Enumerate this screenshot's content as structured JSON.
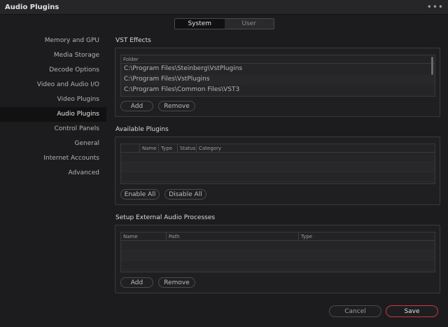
{
  "window": {
    "title": "Audio Plugins",
    "menu_icon": "more-horizontal-icon"
  },
  "tabs": {
    "system": "System",
    "user": "User",
    "selected": "System"
  },
  "sidebar": {
    "selected": "Audio Plugins",
    "items": [
      {
        "label": "Memory and GPU"
      },
      {
        "label": "Media Storage"
      },
      {
        "label": "Decode Options"
      },
      {
        "label": "Video and Audio I/O"
      },
      {
        "label": "Video Plugins"
      },
      {
        "label": "Audio Plugins"
      },
      {
        "label": "Control Panels"
      },
      {
        "label": "General"
      },
      {
        "label": "Internet Accounts"
      },
      {
        "label": "Advanced"
      }
    ]
  },
  "vst": {
    "title": "VST Effects",
    "column": "Folder",
    "folders": [
      "C:\\Program Files\\Steinberg\\VstPlugins",
      "C:\\Program Files\\VstPlugins",
      "C:\\Program Files\\Common Files\\VST3"
    ],
    "add_label": "Add",
    "remove_label": "Remove"
  },
  "available": {
    "title": "Available Plugins",
    "columns": [
      "Name",
      "Type",
      "Status",
      "Category"
    ],
    "enable_all_label": "Enable All",
    "disable_all_label": "Disable All"
  },
  "external": {
    "title": "Setup External Audio Processes",
    "columns": [
      "Name",
      "Path",
      "Type"
    ],
    "add_label": "Add",
    "remove_label": "Remove"
  },
  "footer": {
    "cancel_label": "Cancel",
    "save_label": "Save",
    "save_color": "#c8383c"
  }
}
